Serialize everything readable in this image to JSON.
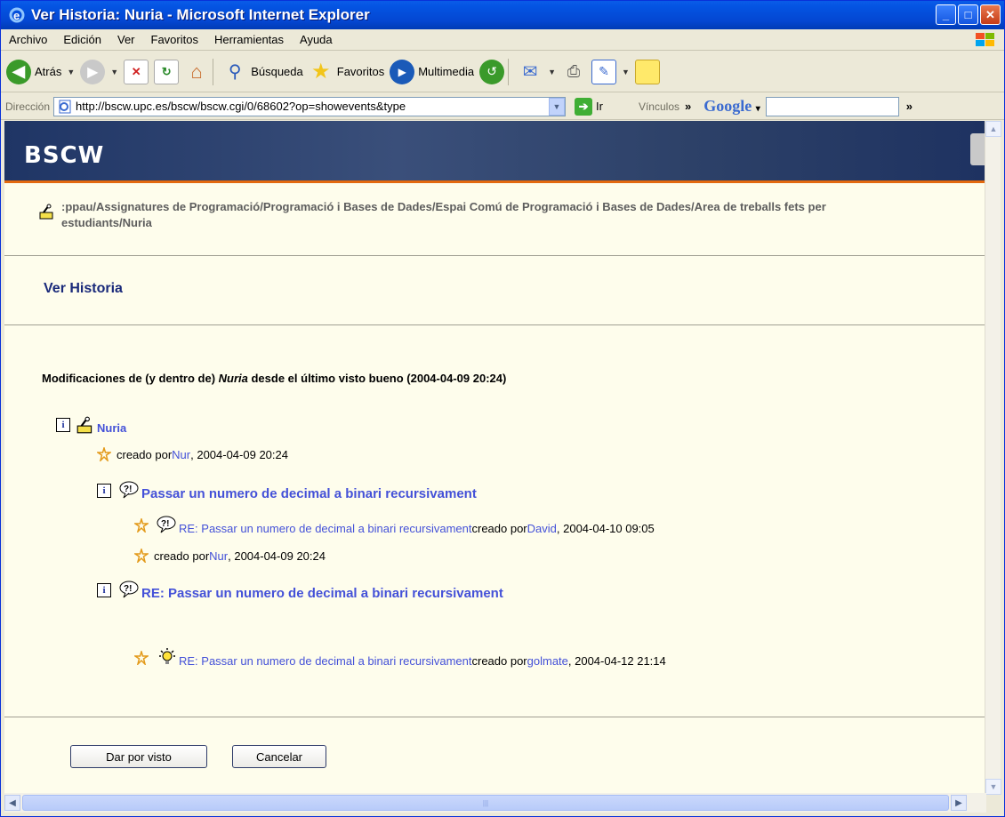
{
  "window": {
    "title": "Ver Historia: Nuria - Microsoft Internet Explorer"
  },
  "menu": [
    "Archivo",
    "Edición",
    "Ver",
    "Favoritos",
    "Herramientas",
    "Ayuda"
  ],
  "toolbar": {
    "back": "Atrás",
    "search": "Búsqueda",
    "favorites": "Favoritos",
    "media": "Multimedia"
  },
  "address": {
    "label": "Dirección",
    "url": "http://bscw.upc.es/bscw/bscw.cgi/0/68602?op=showevents&type",
    "go": "Ir",
    "links": "Vínculos",
    "google": "Google"
  },
  "page": {
    "logo": "BSCW",
    "path": ":ppau/Assignatures de Programació/Programació i Bases de Dades/Espai Comú de Programació i Bases de Dades/Area de treballs fets per estudiants/Nuria",
    "heading": "Ver Historia",
    "mods_pre": "Modificaciones de (y dentro de) ",
    "mods_name": "Nuria",
    "mods_post": " desde el último visto bueno (2004-04-09 20:24)",
    "tree": {
      "root": "Nuria",
      "root_event": {
        "pre": "creado por ",
        "user": "Nur",
        "post": ", 2004-04-09 20:24"
      },
      "item1": {
        "title": "Passar un numero de decimal a binari recursivament",
        "event1": {
          "link": "RE: Passar un numero de decimal a binari recursivament",
          "pre": " creado por ",
          "user": "David",
          "post": ", 2004-04-10 09:05"
        },
        "event2": {
          "pre": "creado por ",
          "user": "Nur",
          "post": ", 2004-04-09 20:24"
        }
      },
      "item2": {
        "title": "RE: Passar un numero de decimal a binari recursivament",
        "event1": {
          "link": "RE: Passar un numero de decimal a binari recursivament",
          "pre": " creado por ",
          "user": "golmate",
          "post": ", 2004-04-12 21:14"
        }
      }
    },
    "buttons": {
      "ok": "Dar por visto",
      "cancel": "Cancelar"
    }
  }
}
